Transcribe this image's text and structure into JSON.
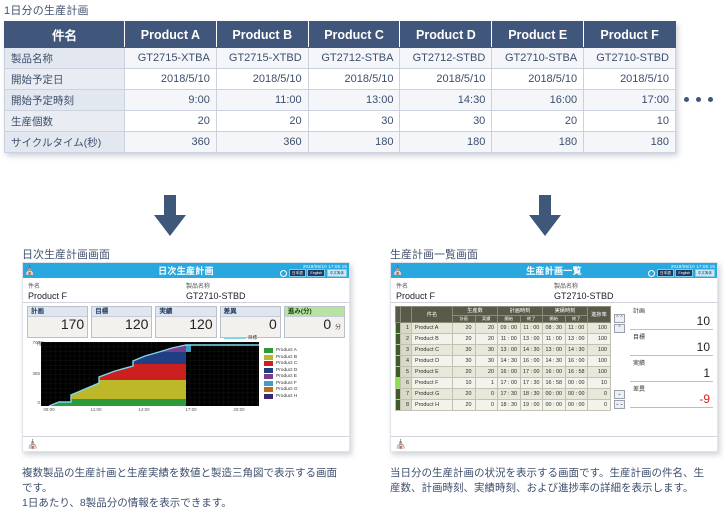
{
  "top_caption": "1日分の生産計画",
  "plan_table": {
    "corner_header": "件名",
    "column_headers": [
      "Product A",
      "Product B",
      "Product C",
      "Product D",
      "Product E",
      "Product F"
    ],
    "rows": [
      {
        "label": "製品名称",
        "values": [
          "GT2715-XTBA",
          "GT2715-XTBD",
          "GT2712-STBA",
          "GT2712-STBD",
          "GT2710-STBA",
          "GT2710-STBD"
        ]
      },
      {
        "label": "開始予定日",
        "values": [
          "2018/5/10",
          "2018/5/10",
          "2018/5/10",
          "2018/5/10",
          "2018/5/10",
          "2018/5/10"
        ]
      },
      {
        "label": "開始予定時刻",
        "values": [
          "9:00",
          "11:00",
          "13:00",
          "14:30",
          "16:00",
          "17:00"
        ]
      },
      {
        "label": "生産個数",
        "values": [
          "20",
          "20",
          "30",
          "30",
          "20",
          "10"
        ]
      },
      {
        "label": "サイクルタイム(秒)",
        "values": [
          "360",
          "360",
          "180",
          "180",
          "180",
          "180"
        ]
      }
    ],
    "overflow_indicator": "•••"
  },
  "left_screen": {
    "panel_title": "日次生産計画画面",
    "header": {
      "home_icon": "home-icon",
      "title": "日次生産計画",
      "timestamp": "2018/05/10 17:05:15",
      "globe_icon": "globe-icon",
      "languages": [
        "日本語",
        "English",
        "中文简体"
      ],
      "active_language": "中文简体"
    },
    "info": {
      "name_label": "件名",
      "name_value": "Product F",
      "product_label": "製品名称",
      "product_value": "GT2710-STBD"
    },
    "kpis": [
      {
        "label": "計画",
        "value": "170",
        "unit": ""
      },
      {
        "label": "目標",
        "value": "120",
        "unit": ""
      },
      {
        "label": "実績",
        "value": "120",
        "unit": ""
      },
      {
        "label": "差異",
        "value": "0",
        "unit": ""
      },
      {
        "label": "進み(分)",
        "value": "0",
        "unit": "分",
        "accent": "#b9e3a0"
      }
    ],
    "chart": {
      "unit_label": "(個)",
      "target_legend": "目標",
      "target_color": "#7fd7ee",
      "y_ticks": [
        "700",
        "385",
        "0"
      ],
      "x_ticks": [
        "08:00",
        "11:00",
        "14:00",
        "17:00",
        "20:00"
      ],
      "legend": [
        {
          "name": "Product A",
          "color": "#2e9b3a"
        },
        {
          "name": "Product B",
          "color": "#bdb72a"
        },
        {
          "name": "Product C",
          "color": "#cc2020"
        },
        {
          "name": "Product D",
          "color": "#1f3f82"
        },
        {
          "name": "Product E",
          "color": "#7a3d8f"
        },
        {
          "name": "Product F",
          "color": "#3d9ec9"
        },
        {
          "name": "Product G",
          "color": "#c06a17"
        },
        {
          "name": "Product H",
          "color": "#3f2470"
        }
      ]
    },
    "footer_home_icon": "home-icon"
  },
  "right_screen": {
    "panel_title": "生産計画一覧画面",
    "header": {
      "home_icon": "home-icon",
      "title": "生産計画一覧",
      "timestamp": "2018/05/10 17:05:15",
      "globe_icon": "globe-icon",
      "languages": [
        "日本語",
        "English",
        "中文简体"
      ],
      "active_language": "中文简体"
    },
    "info": {
      "name_label": "件名",
      "name_value": "Product F",
      "product_label": "製品名称",
      "product_value": "GT2710-STBD"
    },
    "table": {
      "group_headers": [
        "",
        "",
        "件名",
        "生産数",
        "計画時刻",
        "実績時刻",
        "進捗率"
      ],
      "sub_headers": [
        "計画",
        "実績",
        "開始",
        "終了",
        "開始",
        "終了"
      ],
      "rows": [
        {
          "idx": "1",
          "name": "Product A",
          "plan_qty": "20",
          "act_qty": "20",
          "plan_start": "09 : 00",
          "plan_end": "11 : 00",
          "act_start": "08 : 30",
          "act_end": "11 : 00",
          "progress": "100",
          "current": false
        },
        {
          "idx": "2",
          "name": "Product B",
          "plan_qty": "20",
          "act_qty": "20",
          "plan_start": "11 : 00",
          "plan_end": "13 : 00",
          "act_start": "11 : 00",
          "act_end": "13 : 00",
          "progress": "100",
          "current": false
        },
        {
          "idx": "3",
          "name": "Product C",
          "plan_qty": "30",
          "act_qty": "30",
          "plan_start": "13 : 00",
          "plan_end": "14 : 30",
          "act_start": "13 : 00",
          "act_end": "14 : 30",
          "progress": "100",
          "current": false
        },
        {
          "idx": "4",
          "name": "Product D",
          "plan_qty": "30",
          "act_qty": "30",
          "plan_start": "14 : 30",
          "plan_end": "16 : 00",
          "act_start": "14 : 30",
          "act_end": "16 : 00",
          "progress": "100",
          "current": false
        },
        {
          "idx": "5",
          "name": "Product E",
          "plan_qty": "20",
          "act_qty": "20",
          "plan_start": "16 : 00",
          "plan_end": "17 : 00",
          "act_start": "16 : 00",
          "act_end": "16 : 58",
          "progress": "100",
          "current": false
        },
        {
          "idx": "6",
          "name": "Product F",
          "plan_qty": "10",
          "act_qty": "1",
          "plan_start": "17 : 00",
          "plan_end": "17 : 30",
          "act_start": "16 : 58",
          "act_end": "00 : 00",
          "progress": "10",
          "current": true
        },
        {
          "idx": "7",
          "name": "Product G",
          "plan_qty": "20",
          "act_qty": "0",
          "plan_start": "17 : 30",
          "plan_end": "18 : 30",
          "act_start": "00 : 00",
          "act_end": "00 : 00",
          "progress": "0",
          "current": false
        },
        {
          "idx": "8",
          "name": "Product H",
          "plan_qty": "20",
          "act_qty": "0",
          "plan_start": "18 : 30",
          "plan_end": "19 : 00",
          "act_start": "00 : 00",
          "act_end": "00 : 00",
          "progress": "0",
          "current": false
        }
      ]
    },
    "scroll_buttons": [
      "⌃⌃",
      "⌃",
      "⌄",
      "⌄⌄"
    ],
    "kpis": [
      {
        "label": "計画",
        "value": "10"
      },
      {
        "label": "目標",
        "value": "10"
      },
      {
        "label": "実績",
        "value": "1"
      },
      {
        "label": "差異",
        "value": "-9",
        "negative": true
      }
    ],
    "footer_home_icon": "home-icon"
  },
  "descriptions": {
    "left": "複数製品の生産計画と生産実績を数値と製造三角図で表示する画面です。\n1日あたり、8製品分の情報を表示できます。",
    "right": "当日分の生産計画の状況を表示する画面です。生産計画の件名、生産数、計画時刻、実績時刻、および進捗率の詳細を表示します。"
  },
  "chart_data": {
    "type": "area",
    "title": "日次生産計画 製造三角図",
    "xlabel": "",
    "ylabel": "(個)",
    "xlim": [
      "08:00",
      "20:00"
    ],
    "ylim": [
      0,
      700
    ],
    "y_ticks": [
      0,
      385,
      700
    ],
    "x_ticks": [
      "08:00",
      "11:00",
      "14:00",
      "17:00",
      "20:00"
    ],
    "grid": true,
    "legend_position": "right",
    "target_series": {
      "name": "目標",
      "color": "#7fd7ee",
      "values": [
        0,
        20,
        90,
        90,
        250,
        250,
        250,
        420,
        420,
        560,
        560,
        560,
        700,
        700,
        700
      ]
    },
    "series": [
      {
        "name": "Product A",
        "color": "#2e9b3a",
        "value": 90
      },
      {
        "name": "Product B",
        "color": "#bdb72a",
        "value": 160
      },
      {
        "name": "Product C",
        "color": "#cc2020",
        "value": 170
      },
      {
        "name": "Product D",
        "color": "#1f3f82",
        "value": 140
      },
      {
        "name": "Product E",
        "color": "#7a3d8f",
        "value": 85
      },
      {
        "name": "Product F",
        "color": "#3d9ec9",
        "value": 55
      },
      {
        "name": "Product G",
        "color": "#c06a17",
        "value": 0
      },
      {
        "name": "Product H",
        "color": "#3f2470",
        "value": 0
      }
    ]
  }
}
